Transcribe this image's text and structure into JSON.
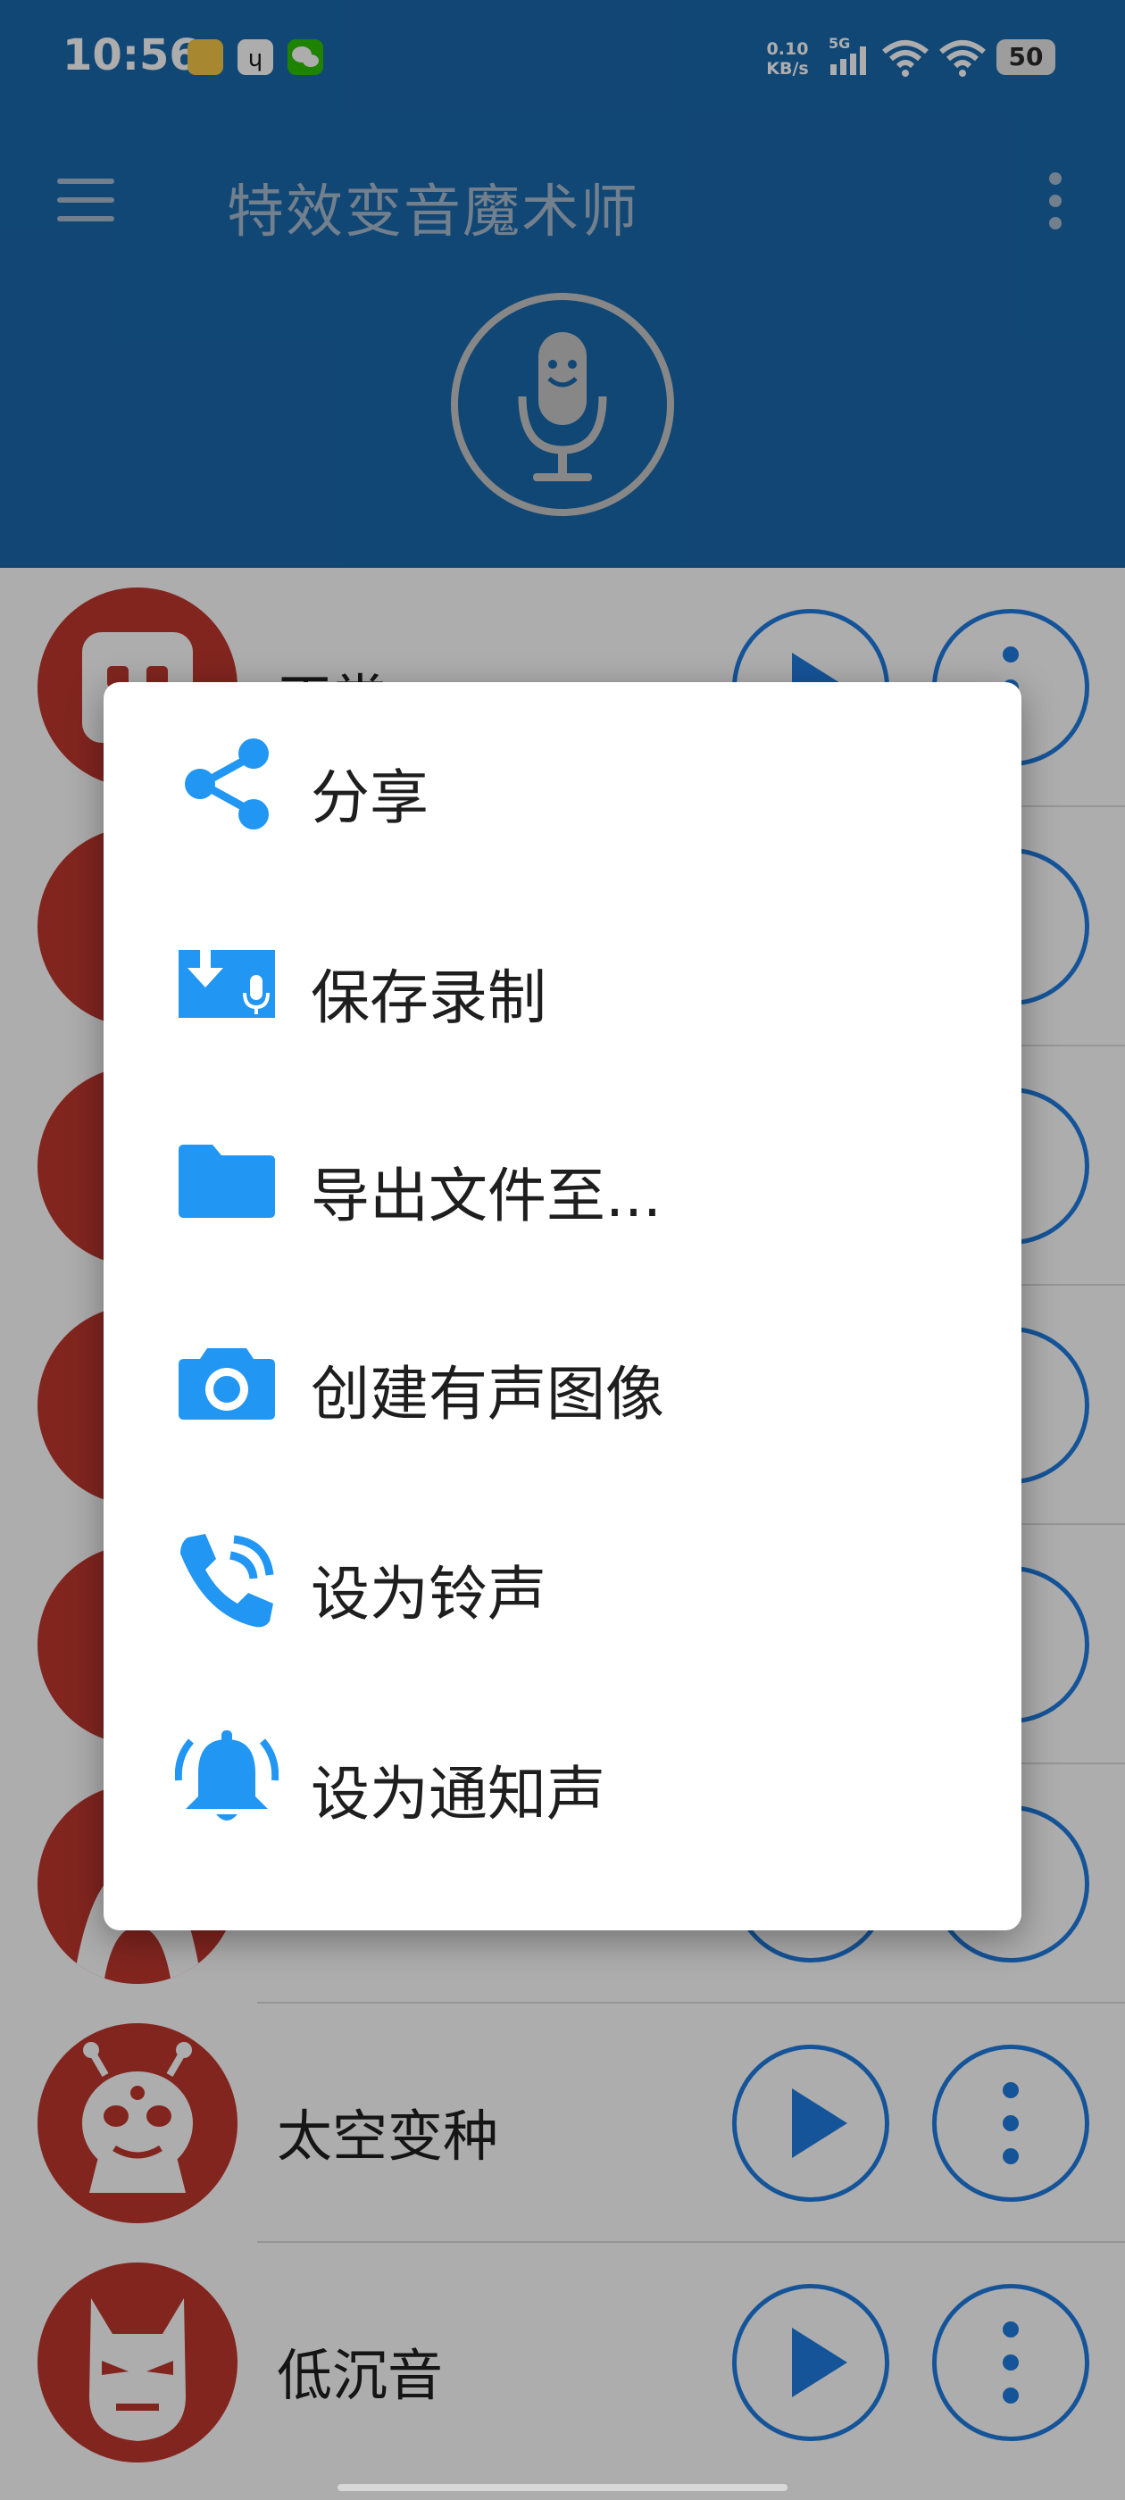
{
  "status_bar": {
    "time": "10:56",
    "net_speed_value": "0.10",
    "net_speed_unit": "KB/s",
    "signal": "5G",
    "battery": "50",
    "notification_icons": [
      "notes-app-icon",
      "transfer-app-icon",
      "wechat-icon"
    ]
  },
  "app_bar": {
    "title": "特效变音魔术师",
    "color": "#1a69ad"
  },
  "effects": [
    {
      "label": "正常",
      "icon": "robot-face-icon"
    },
    {
      "label": "",
      "icon": "effect-icon"
    },
    {
      "label": "",
      "icon": "effect-icon"
    },
    {
      "label": "",
      "icon": "effect-icon"
    },
    {
      "label": "",
      "icon": "effect-icon"
    },
    {
      "label": "",
      "icon": "effect-icon"
    },
    {
      "label": "太空变种",
      "icon": "alien-face-icon"
    },
    {
      "label": "低沉音",
      "icon": "masked-face-icon"
    }
  ],
  "context_menu": {
    "items": [
      {
        "label": "分享",
        "icon": "share-icon"
      },
      {
        "label": "保存录制",
        "icon": "save-recording-icon"
      },
      {
        "label": "导出文件至...",
        "icon": "folder-icon"
      },
      {
        "label": "创建有声图像",
        "icon": "camera-icon"
      },
      {
        "label": "设为铃声",
        "icon": "ringtone-phone-icon"
      },
      {
        "label": "设为通知声",
        "icon": "notification-bell-icon"
      }
    ],
    "icon_color": "#2196f3"
  }
}
